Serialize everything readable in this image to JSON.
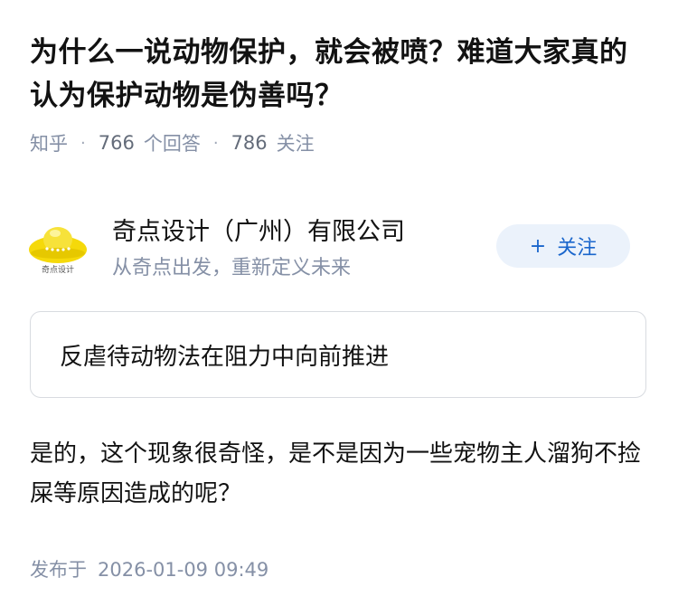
{
  "question": {
    "title": "为什么一说动物保护，就会被喷？难道大家真的认为保护动物是伪善吗？",
    "source": "知乎",
    "answers_count": "766",
    "answers_label": "个回答",
    "followers_count": "786",
    "followers_label": "关注"
  },
  "author": {
    "name": "奇点设计（广州）有限公司",
    "bio": "从奇点出发，重新定义未来",
    "avatar_icon": "ufo-logo-icon",
    "avatar_text": "奇点设计",
    "follow_label": "关注"
  },
  "answer": {
    "quote": "反虐待动物法在阻力中向前推进",
    "body": "是的，这个现象很奇怪，是不是因为一些宠物主人溜狗不捡屎等原因造成的呢？",
    "publish_label": "发布于",
    "publish_time": "2026-01-09 09:49"
  },
  "colors": {
    "accent": "#1a66cc",
    "follow_bg": "#ebf2fb",
    "meta_text": "#8590a6",
    "logo_yellow": "#f5d90a"
  }
}
